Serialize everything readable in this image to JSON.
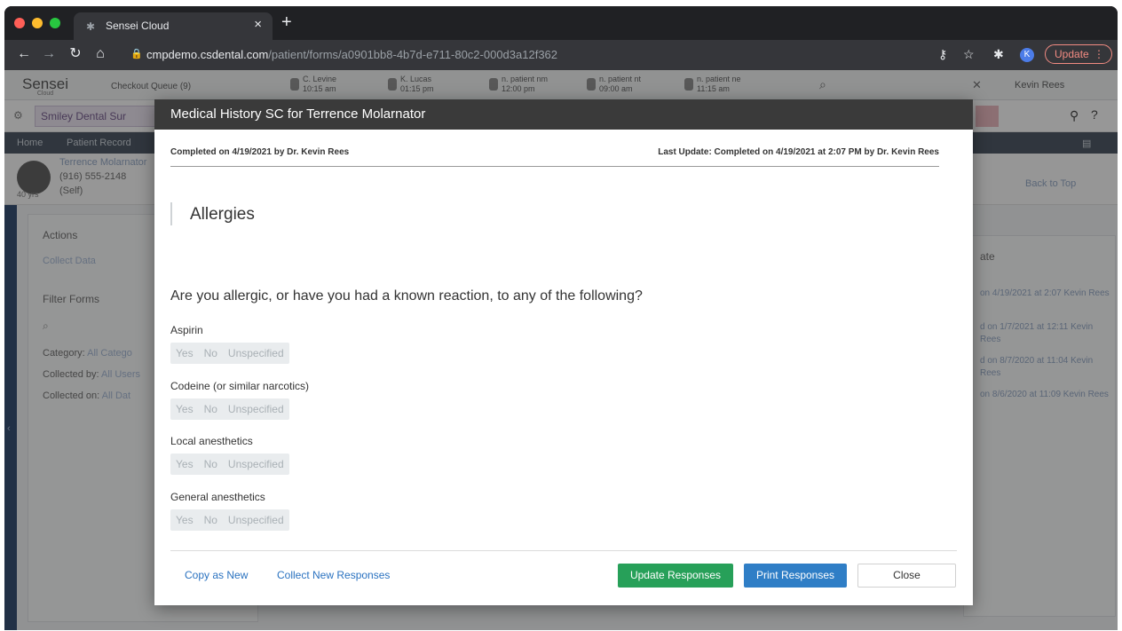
{
  "browser": {
    "tab_title": "Sensei Cloud",
    "tab_close": "×",
    "new_tab": "+",
    "url_host": "cmpdemo.csdental.com",
    "url_path": "/patient/forms/a0901bb8-4b7d-e711-80c2-000d3a12f362",
    "profile_initial": "K",
    "update_label": "Update",
    "update_menu": "⋮"
  },
  "app": {
    "logo": "Sensei",
    "logo_sub": "Cloud",
    "checkout_queue": "Checkout Queue (9)",
    "queue": [
      {
        "name": "C. Levine",
        "time": "10:15 am"
      },
      {
        "name": "K. Lucas",
        "time": "01:15 pm"
      },
      {
        "name": "n. patient nm",
        "time": "12:00 pm"
      },
      {
        "name": "n. patient nt",
        "time": "09:00 am"
      },
      {
        "name": "n. patient ne",
        "time": "11:15 am"
      }
    ],
    "user": "Kevin Rees",
    "location": "Smiley Dental Sur",
    "nav": [
      "Home",
      "Patient Record"
    ],
    "patient_name": "Terrence Molarnator",
    "patient_phone": "(916) 555-2148",
    "patient_age": "40 yrs",
    "patient_relation": "(Self)",
    "back_to_top": "Back to Top",
    "sidebar": {
      "actions": "Actions",
      "collect_data": "Collect Data",
      "filter_forms": "Filter Forms",
      "category_label": "Category:",
      "category_value": "All Catego",
      "collected_by_label": "Collected by:",
      "collected_by_value": "All Users",
      "collected_on_label": "Collected on:",
      "collected_on_value": "All Dat"
    },
    "table": {
      "header": "ate",
      "rows": [
        "on 4/19/2021 at 2:07 Kevin Rees",
        "d on 1/7/2021 at 12:11 Kevin Rees",
        "d on 8/7/2020 at 11:04 Kevin Rees",
        "on 8/6/2020 at 11:09 Kevin Rees"
      ]
    }
  },
  "modal": {
    "title": "Medical History SC for Terrence Molarnator",
    "completed": "Completed on 4/19/2021 by Dr. Kevin Rees",
    "last_update": "Last Update: Completed on 4/19/2021 at 2:07 PM by Dr. Kevin Rees",
    "section": "Allergies",
    "question": "Are you allergic, or have you had a known reaction, to any of the following?",
    "options": [
      "Yes",
      "No",
      "Unspecified"
    ],
    "items": [
      {
        "label": "Aspirin"
      },
      {
        "label": "Codeine (or similar narcotics)"
      },
      {
        "label": "Local anesthetics"
      },
      {
        "label": "General anesthetics"
      }
    ],
    "footer": {
      "copy_as_new": "Copy as New",
      "collect_new": "Collect New Responses",
      "update": "Update Responses",
      "print": "Print Responses",
      "close": "Close"
    }
  },
  "colors": {
    "update_button": "#27a059",
    "print_button": "#2f7ec6",
    "link": "#2a72c0",
    "modal_header": "#3a3a3a"
  }
}
